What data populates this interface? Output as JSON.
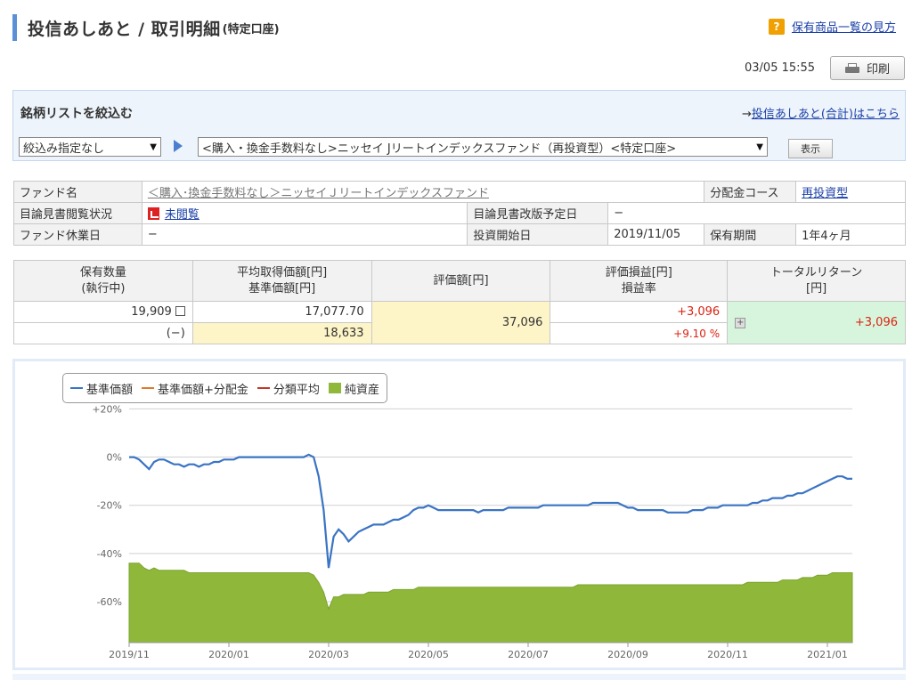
{
  "page": {
    "title": "投信あしあと / 取引明細",
    "title_sub": "(特定口座)",
    "help_label": "保有商品一覧の見方",
    "help_icon": "?",
    "timestamp": "03/05 15:55",
    "print_label": "印刷"
  },
  "filter": {
    "title": "銘柄リストを絞込む",
    "link_prefix": "→",
    "link_text": "投信あしあと(合計)はこちら",
    "select1_value": "絞込み指定なし",
    "select2_value": "<購入・換金手数料なし>ニッセイ Jリートインデックスファンド（再投資型）<特定口座>",
    "show_label": "表示"
  },
  "info": {
    "fund_name_label": "ファンド名",
    "fund_name": "＜購入･換金手数料なし＞ニッセイＪリートインデックスファンド",
    "course_label": "分配金コース",
    "course": "再投資型",
    "prospectus_label": "目論見書閲覧状況",
    "prospectus": "未閲覧",
    "revision_label": "目論見書改版予定日",
    "revision": "−",
    "closed_label": "ファンド休業日",
    "closed": "−",
    "start_label": "投資開始日",
    "start": "2019/11/05",
    "period_label": "保有期間",
    "period": "1年4ヶ月"
  },
  "holding": {
    "headers": {
      "qty_1": "保有数量",
      "qty_2": "(執行中)",
      "avg_1": "平均取得価額[円]",
      "avg_2": "基準価額[円]",
      "val": "評価額[円]",
      "pl_1": "評価損益[円]",
      "pl_2": "損益率",
      "tr_1": "トータルリターン",
      "tr_2": "[円]"
    },
    "qty": "19,909",
    "pending": "(−)",
    "avg_cost": "17,077.70",
    "nav": "18,633",
    "value": "37,096",
    "pl": "+3,096",
    "pl_rate": "+9.10 %",
    "total_return": "+3,096"
  },
  "chart_data": {
    "type": "line",
    "legend_placement": "top-left",
    "grid": true,
    "series": [
      {
        "name": "基準価額",
        "color": "#3a74c4"
      },
      {
        "name": "基準価額+分配金",
        "color": "#e07a2a"
      },
      {
        "name": "分類平均",
        "color": "#c0392b"
      },
      {
        "name": "純資産",
        "color": "#8fb83a"
      }
    ],
    "y_ticks": [
      "+20%",
      "0%",
      "-20%",
      "-40%",
      "-60%"
    ],
    "ylim": [
      -77,
      22
    ],
    "x_ticks": [
      "2019/11",
      "2020/01",
      "2020/03",
      "2020/05",
      "2020/07",
      "2020/09",
      "2020/11",
      "2021/01"
    ],
    "x_tick_index": [
      0,
      20,
      40,
      60,
      80,
      100,
      120,
      140
    ],
    "nav_pct": [
      0,
      0,
      -1,
      -3,
      -5,
      -2,
      -1,
      -1,
      -2,
      -3,
      -3,
      -4,
      -3,
      -3,
      -4,
      -3,
      -3,
      -2,
      -2,
      -1,
      -1,
      -1,
      0,
      0,
      0,
      0,
      0,
      0,
      0,
      0,
      0,
      0,
      0,
      0,
      0,
      0,
      1,
      0,
      -8,
      -22,
      -46,
      -33,
      -30,
      -32,
      -35,
      -33,
      -31,
      -30,
      -29,
      -28,
      -28,
      -28,
      -27,
      -26,
      -26,
      -25,
      -24,
      -22,
      -21,
      -21,
      -20,
      -21,
      -22,
      -22,
      -22,
      -22,
      -22,
      -22,
      -22,
      -22,
      -23,
      -22,
      -22,
      -22,
      -22,
      -22,
      -21,
      -21,
      -21,
      -21,
      -21,
      -21,
      -21,
      -20,
      -20,
      -20,
      -20,
      -20,
      -20,
      -20,
      -20,
      -20,
      -20,
      -19,
      -19,
      -19,
      -19,
      -19,
      -19,
      -20,
      -21,
      -21,
      -22,
      -22,
      -22,
      -22,
      -22,
      -22,
      -23,
      -23,
      -23,
      -23,
      -23,
      -22,
      -22,
      -22,
      -21,
      -21,
      -21,
      -20,
      -20,
      -20,
      -20,
      -20,
      -20,
      -19,
      -19,
      -18,
      -18,
      -17,
      -17,
      -17,
      -16,
      -16,
      -15,
      -15,
      -14,
      -13,
      -12,
      -11,
      -10,
      -9,
      -8,
      -8,
      -9,
      -9
    ],
    "net_assets_pct": [
      -44,
      -44,
      -44,
      -46,
      -47,
      -46,
      -47,
      -47,
      -47,
      -47,
      -47,
      -47,
      -48,
      -48,
      -48,
      -48,
      -48,
      -48,
      -48,
      -48,
      -48,
      -48,
      -48,
      -48,
      -48,
      -48,
      -48,
      -48,
      -48,
      -48,
      -48,
      -48,
      -48,
      -48,
      -48,
      -48,
      -48,
      -49,
      -52,
      -56,
      -63,
      -58,
      -58,
      -57,
      -57,
      -57,
      -57,
      -57,
      -56,
      -56,
      -56,
      -56,
      -56,
      -55,
      -55,
      -55,
      -55,
      -55,
      -54,
      -54,
      -54,
      -54,
      -54,
      -54,
      -54,
      -54,
      -54,
      -54,
      -54,
      -54,
      -54,
      -54,
      -54,
      -54,
      -54,
      -54,
      -54,
      -54,
      -54,
      -54,
      -54,
      -54,
      -54,
      -54,
      -54,
      -54,
      -54,
      -54,
      -54,
      -54,
      -53,
      -53,
      -53,
      -53,
      -53,
      -53,
      -53,
      -53,
      -53,
      -53,
      -53,
      -53,
      -53,
      -53,
      -53,
      -53,
      -53,
      -53,
      -53,
      -53,
      -53,
      -53,
      -53,
      -53,
      -53,
      -53,
      -53,
      -53,
      -53,
      -53,
      -53,
      -53,
      -53,
      -53,
      -52,
      -52,
      -52,
      -52,
      -52,
      -52,
      -52,
      -51,
      -51,
      -51,
      -51,
      -50,
      -50,
      -50,
      -49,
      -49,
      -49,
      -48,
      -48,
      -48,
      -48,
      -48
    ]
  }
}
